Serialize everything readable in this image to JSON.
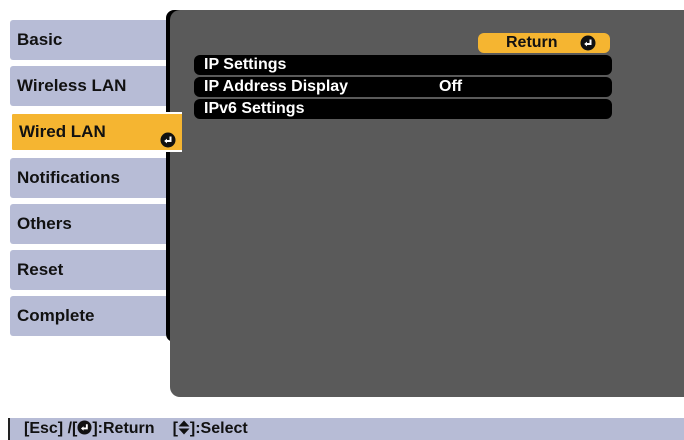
{
  "sidebar": {
    "items": [
      {
        "label": "Basic"
      },
      {
        "label": "Wireless LAN"
      },
      {
        "label": "Wired LAN",
        "active": true
      },
      {
        "label": "Notifications"
      },
      {
        "label": "Others"
      },
      {
        "label": "Reset"
      },
      {
        "label": "Complete"
      }
    ]
  },
  "main": {
    "return_label": "Return",
    "rows": [
      {
        "label": "IP Settings",
        "value": ""
      },
      {
        "label": "IP Address Display",
        "value": "Off"
      },
      {
        "label": "IPv6 Settings",
        "value": ""
      }
    ]
  },
  "status_bar": {
    "esc_prefix": "[Esc] /[",
    "return_suffix": "]:Return",
    "select_prefix": "[",
    "select_suffix": "]:Select"
  },
  "colors": {
    "tab_bg": "#b7bcd6",
    "active_accent": "#f5b531",
    "panel_bg": "#5a5a5a",
    "row_bg": "#000000"
  },
  "icons": {
    "enter": "enter-icon",
    "updown": "up-down-arrow-icon"
  }
}
